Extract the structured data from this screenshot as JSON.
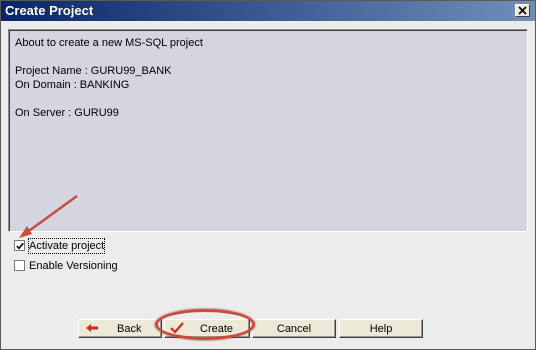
{
  "window": {
    "title": "Create Project"
  },
  "message": {
    "intro": "About to create a new MS-SQL project",
    "project_name": "Project Name : GURU99_BANK",
    "domain": "On Domain : BANKING",
    "server": "On Server :  GURU99"
  },
  "options": {
    "activate_project": {
      "label": "Activate project",
      "checked": true
    },
    "enable_versioning": {
      "label": "Enable Versioning",
      "checked": false
    }
  },
  "buttons": {
    "back": "Back",
    "create": "Create",
    "cancel": "Cancel",
    "help": "Help"
  },
  "annotations": {
    "color": "#c94c3c",
    "arrow_target": "Activate project checkbox",
    "highlight_target": "Create button"
  },
  "icons": {
    "back": "left-arrow-icon",
    "create": "checkmark-icon",
    "close": "close-x-icon"
  }
}
